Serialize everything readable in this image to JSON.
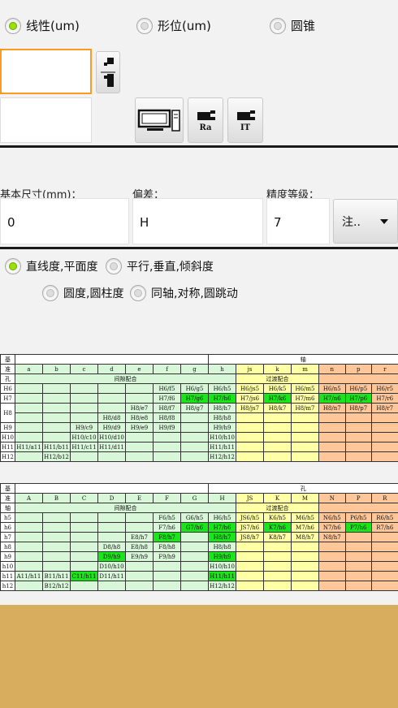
{
  "top_radios": [
    {
      "label": "线性(um)",
      "checked": true
    },
    {
      "label": "形位(um)",
      "checked": false
    },
    {
      "label": "圆锥",
      "checked": false
    }
  ],
  "buttons": {
    "ra": "Ra",
    "it": "IT",
    "note": "注.."
  },
  "labels": {
    "size": "基本尺寸(mm)：",
    "dev": "偏差：",
    "grade": "精度等级："
  },
  "inputs": {
    "size": "0",
    "dev": "H",
    "grade": "7"
  },
  "sub_radios": [
    {
      "label": "直线度,平面度",
      "checked": true
    },
    {
      "label": "平行,垂直,倾斜度",
      "checked": false
    },
    {
      "label": "圆度,圆柱度",
      "checked": false
    },
    {
      "label": "同轴,对称,圆跳动",
      "checked": false
    }
  ],
  "colors": {
    "accent_focus": "#ff9a1e",
    "radio_on": "#9be000",
    "clearance": "#d8f7d8",
    "transition": "#ffffa6",
    "interference": "#ffc699",
    "preferred": "#19e619",
    "bottom_panel": "#d9ad5e"
  },
  "hole_table": {
    "corner": [
      "基",
      "准",
      "孔"
    ],
    "group": "轴",
    "letters": [
      "a",
      "b",
      "c",
      "d",
      "e",
      "f",
      "g",
      "h",
      "js",
      "k",
      "m",
      "n",
      "p",
      "r"
    ],
    "zones": [
      "间隙配合",
      "过渡配合"
    ],
    "rows": [
      {
        "h": "H6",
        "c": [
          "",
          "",
          "",
          "",
          "",
          "H6/f5",
          "H6/g5",
          "H6/h5",
          "H6/js5",
          "H6/k5",
          "H6/m5",
          "H6/n5",
          "H6/p5",
          "H6/r5"
        ],
        "hl": []
      },
      {
        "h": "H7",
        "c": [
          "",
          "",
          "",
          "",
          "",
          "H7/f6",
          "H7/g6",
          "H7/h6",
          "H7/js6",
          "H7/k6",
          "H7/m6",
          "H7/n6",
          "H7/p6",
          "H7/r6"
        ],
        "hl": [
          6,
          7,
          9,
          11,
          12
        ]
      },
      {
        "h": "H8",
        "c": [
          "",
          "",
          "",
          "",
          "H8/e7",
          "H8/f7",
          "H8/g7",
          "H8/h7",
          "H8/js7",
          "H8/k7",
          "H8/m7",
          "H8/n7",
          "H8/p7",
          "H8/r7"
        ],
        "hl": []
      },
      {
        "h": "",
        "c": [
          "",
          "",
          "",
          "H8/d8",
          "H8/e8",
          "H8/f8",
          "",
          "H8/h8",
          "",
          "",
          "",
          "",
          "",
          ""
        ],
        "hl": []
      },
      {
        "h": "H9",
        "c": [
          "",
          "",
          "H9/c9",
          "H9/d9",
          "H9/e9",
          "H9/f9",
          "",
          "H9/h9",
          "",
          "",
          "",
          "",
          "",
          ""
        ],
        "hl": []
      },
      {
        "h": "H10",
        "c": [
          "",
          "",
          "H10/c10",
          "H10/d10",
          "",
          "",
          "",
          "H10/h10",
          "",
          "",
          "",
          "",
          "",
          ""
        ],
        "hl": []
      },
      {
        "h": "H11",
        "c": [
          "H11/a11",
          "H11/b11",
          "H11/c11",
          "H11/d11",
          "",
          "",
          "",
          "H11/h11",
          "",
          "",
          "",
          "",
          "",
          ""
        ],
        "hl": []
      },
      {
        "h": "H12",
        "c": [
          "",
          "H12/b12",
          "",
          "",
          "",
          "",
          "",
          "H12/h12",
          "",
          "",
          "",
          "",
          "",
          ""
        ],
        "hl": []
      }
    ]
  },
  "shaft_table": {
    "corner": [
      "基",
      "准",
      "轴"
    ],
    "group": "孔",
    "letters": [
      "A",
      "B",
      "C",
      "D",
      "E",
      "F",
      "G",
      "H",
      "JS",
      "K",
      "M",
      "N",
      "P",
      "R"
    ],
    "zones": [
      "间隙配合",
      "过渡配合"
    ],
    "rows": [
      {
        "h": "h5",
        "c": [
          "",
          "",
          "",
          "",
          "",
          "F6/h5",
          "G6/h5",
          "H6/h5",
          "JS6/h5",
          "K6/h5",
          "M6/h5",
          "N6/h5",
          "P6/h5",
          "R6/h5"
        ],
        "hl": []
      },
      {
        "h": "h6",
        "c": [
          "",
          "",
          "",
          "",
          "",
          "F7/h6",
          "G7/h6",
          "H7/h6",
          "JS7/h6",
          "K7/h6",
          "M7/h6",
          "N7/h6",
          "P7/h6",
          "R7/h6"
        ],
        "hl": [
          6,
          7,
          9,
          12
        ]
      },
      {
        "h": "h7",
        "c": [
          "",
          "",
          "",
          "",
          "E8/h7",
          "F8/h7",
          "",
          "H8/h7",
          "JS8/h7",
          "K8/h7",
          "M8/h7",
          "N8/h7",
          "",
          ""
        ],
        "hl": [
          5,
          7
        ]
      },
      {
        "h": "h8",
        "c": [
          "",
          "",
          "",
          "D8/h8",
          "E8/h8",
          "F8/h8",
          "",
          "H8/h8",
          "",
          "",
          "",
          "",
          "",
          ""
        ],
        "hl": []
      },
      {
        "h": "h9",
        "c": [
          "",
          "",
          "",
          "D9/h9",
          "E9/h9",
          "F9/h9",
          "",
          "H9/h9",
          "",
          "",
          "",
          "",
          "",
          ""
        ],
        "hl": [
          3,
          7
        ]
      },
      {
        "h": "h10",
        "c": [
          "",
          "",
          "",
          "D10/h10",
          "",
          "",
          "",
          "H10/h10",
          "",
          "",
          "",
          "",
          "",
          ""
        ],
        "hl": []
      },
      {
        "h": "h11",
        "c": [
          "A11/h11",
          "B11/h11",
          "C11/h11",
          "D11/h11",
          "",
          "",
          "",
          "H11/h11",
          "",
          "",
          "",
          "",
          "",
          ""
        ],
        "hl": [
          2,
          7
        ]
      },
      {
        "h": "h12",
        "c": [
          "",
          "B12/h12",
          "",
          "",
          "",
          "",
          "",
          "H12/h12",
          "",
          "",
          "",
          "",
          "",
          ""
        ],
        "hl": []
      }
    ]
  }
}
